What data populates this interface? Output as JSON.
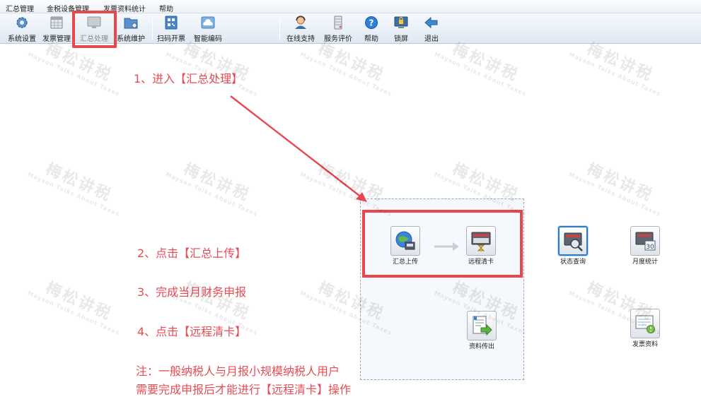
{
  "menu": {
    "items": [
      "汇总管理",
      "金税设备管理",
      "发票资料统计",
      "帮助"
    ]
  },
  "toolbar": {
    "system_settings": "系统设置",
    "invoice_management": "发票管理",
    "summary_processing": "汇总处理",
    "system_maintenance": "系统维护",
    "scan_issue": "扫码开票",
    "smart_coding": "智能编码",
    "online_support": "在线支持",
    "service_rating": "服务评价",
    "help": "帮助",
    "lock_screen": "锁屏",
    "exit": "退出"
  },
  "functions": {
    "summary_upload": "汇总上传",
    "remote_clear": "远程清卡",
    "data_export": "资料传出",
    "status_query": "状态查询",
    "monthly_stats": "月度统计",
    "invoice_data": "发票资料"
  },
  "instructions": {
    "step1": "1、进入【汇总处理】",
    "step2": "2、点击【汇总上传】",
    "step3": "3、完成当月财务申报",
    "step4": "4、点击【远程清卡】",
    "note_line1": "注：一般纳税人与月报小规模纳税人用户",
    "note_line2": "需要完成申报后才能进行【远程清卡】操作"
  },
  "watermark": {
    "cn": "梅松讲税",
    "en": "Mayson Talks About Taxes"
  },
  "colors": {
    "highlight": "#e8474e",
    "instruction_text": "#e64c55",
    "active_tile_border": "#2f79c9"
  },
  "icons": {
    "calendar_day": "30"
  }
}
